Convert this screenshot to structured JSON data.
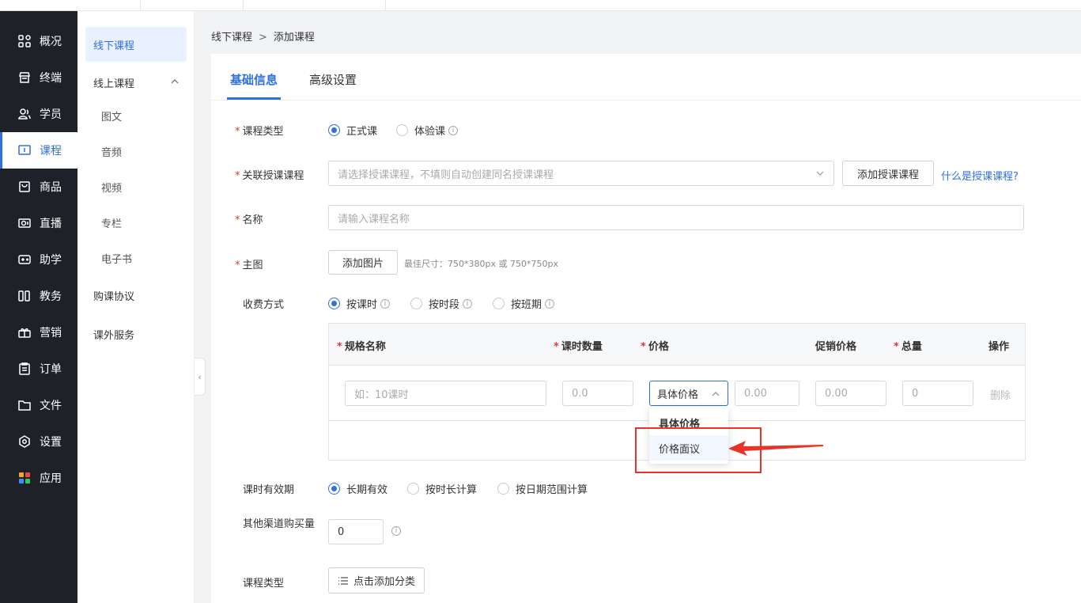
{
  "breadcrumb": {
    "parent": "线下课程",
    "current": "添加课程"
  },
  "main_nav": [
    {
      "label": "概况",
      "icon": "grid-icon"
    },
    {
      "label": "终端",
      "icon": "store-icon"
    },
    {
      "label": "学员",
      "icon": "users-icon"
    },
    {
      "label": "课程",
      "icon": "course-icon",
      "active": true
    },
    {
      "label": "商品",
      "icon": "bag-icon"
    },
    {
      "label": "直播",
      "icon": "camera-icon"
    },
    {
      "label": "助学",
      "icon": "gamepad-icon"
    },
    {
      "label": "教务",
      "icon": "book-icon"
    },
    {
      "label": "营销",
      "icon": "gift-icon"
    },
    {
      "label": "订单",
      "icon": "clipboard-icon"
    },
    {
      "label": "文件",
      "icon": "folder-icon"
    },
    {
      "label": "设置",
      "icon": "gear-icon"
    },
    {
      "label": "应用",
      "icon": "apps-icon"
    }
  ],
  "sub_nav": {
    "offline": "线下课程",
    "online": "线上课程",
    "online_children": [
      "图文",
      "音频",
      "视频",
      "专栏",
      "电子书"
    ],
    "agreement": "购课协议",
    "extra": "课外服务"
  },
  "tabs": {
    "basic": "基础信息",
    "advanced": "高级设置"
  },
  "form": {
    "course_type": {
      "label": "课程类型",
      "options": [
        "正式课",
        "体验课"
      ]
    },
    "related": {
      "label": "关联授课课程",
      "placeholder": "请选择授课课程，不填则自动创建同名授课课程",
      "add_button": "添加授课课程",
      "help_link": "什么是授课课程?"
    },
    "name": {
      "label": "名称",
      "placeholder": "请输入课程名称"
    },
    "image": {
      "label": "主图",
      "button": "添加图片",
      "hint": "最佳尺寸：750*380px 或 750*750px"
    },
    "fee": {
      "label": "收费方式",
      "options": [
        "按课时",
        "按时段",
        "按班期"
      ]
    },
    "spec_table": {
      "headers": {
        "name": "规格名称",
        "count": "课时数量",
        "price": "价格",
        "promo": "促销价格",
        "total": "总量",
        "action": "操作"
      },
      "row": {
        "name_placeholder": "如：10课时",
        "count_placeholder": "0.0",
        "price_type": "具体价格",
        "price_placeholder": "0.00",
        "promo_placeholder": "0.00",
        "total_placeholder": "0",
        "delete": "删除"
      },
      "dropdown_options": [
        "具体价格",
        "价格面议"
      ]
    },
    "validity": {
      "label": "课时有效期",
      "options": [
        "长期有效",
        "按时长计算",
        "按日期范围计算"
      ]
    },
    "channel": {
      "label": "其他渠道购买量",
      "value": "0"
    },
    "category": {
      "label": "课程类型",
      "button": "点击添加分类"
    }
  },
  "colors": {
    "accent": "#2f6fe4",
    "annotation": "#e8322a",
    "sidebar": "#1f2128"
  }
}
